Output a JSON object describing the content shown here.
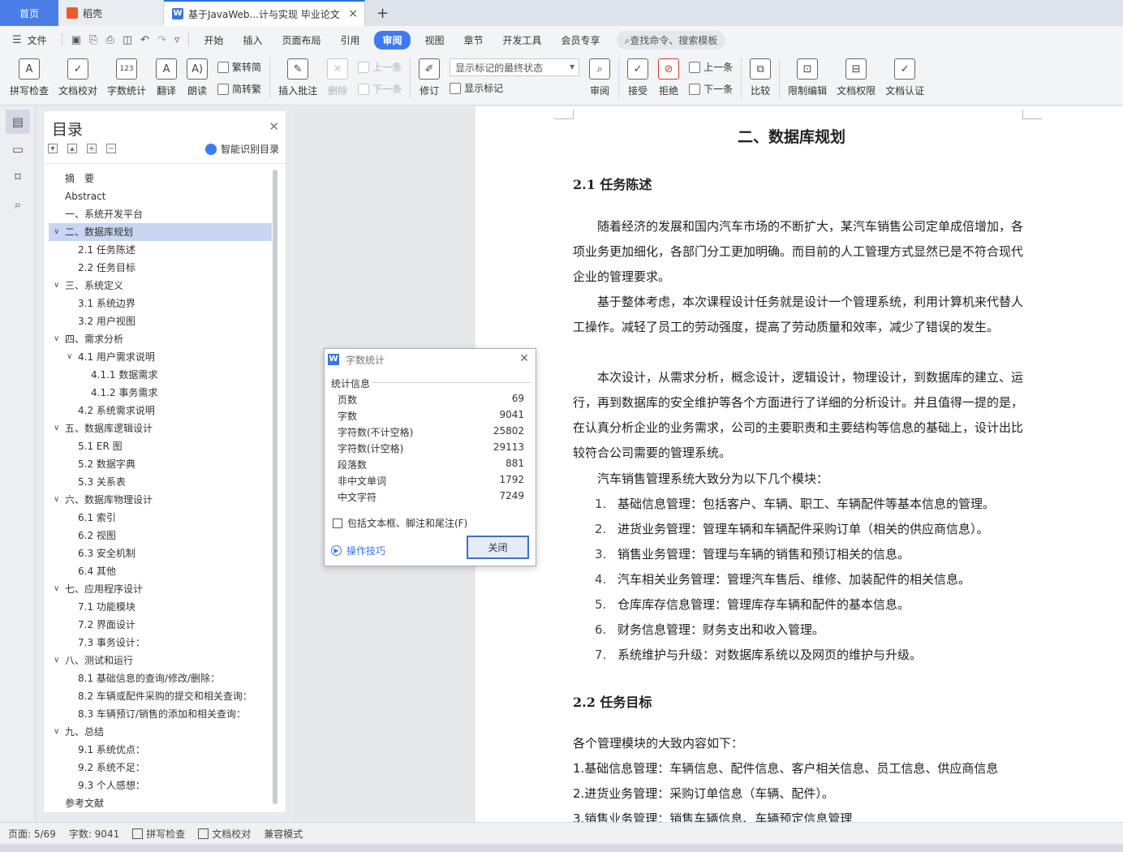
{
  "tabs": {
    "home": "首页",
    "daoke": "稻壳",
    "doc": "基于JavaWeb...计与实现 毕业论文",
    "add": "+"
  },
  "menu": {
    "file": "文件",
    "items": [
      "开始",
      "插入",
      "页面布局",
      "引用",
      "审阅",
      "视图",
      "章节",
      "开发工具",
      "会员专享"
    ],
    "active": "审阅",
    "search": "查找命令、搜索模板"
  },
  "ribbon": {
    "spell": "拼写检查",
    "proof": "文档校对",
    "wordcount": "字数统计",
    "translate": "翻译",
    "read": "朗读",
    "t2s": "繁转简",
    "s2t": "简转繁",
    "insert_comment": "插入批注",
    "delete": "删除",
    "prev_comment": "上一条",
    "next_comment": "下一条",
    "revise": "修订",
    "markup_select": "显示标记的最终状态",
    "show_markup": "显示标记",
    "review": "审阅",
    "accept": "接受",
    "reject": "拒绝",
    "prev_change": "上一条",
    "next_change": "下一条",
    "compare": "比较",
    "restrict": "限制编辑",
    "permission": "文档权限",
    "certify": "文档认证"
  },
  "toc": {
    "title": "目录",
    "smart": "智能识别目录",
    "items": [
      {
        "label": "摘　要",
        "level": 0,
        "arrow": ""
      },
      {
        "label": "Abstract",
        "level": 0,
        "arrow": ""
      },
      {
        "label": "一、系统开发平台",
        "level": 0,
        "arrow": ""
      },
      {
        "label": "二、数据库规划",
        "level": 0,
        "arrow": "v",
        "selected": true
      },
      {
        "label": "2.1  任务陈述",
        "level": 1,
        "arrow": ""
      },
      {
        "label": "2.2  任务目标",
        "level": 1,
        "arrow": ""
      },
      {
        "label": "三、系统定义",
        "level": 0,
        "arrow": "v"
      },
      {
        "label": "3.1  系统边界",
        "level": 1,
        "arrow": ""
      },
      {
        "label": "3.2  用户视图",
        "level": 1,
        "arrow": ""
      },
      {
        "label": "四、需求分析",
        "level": 0,
        "arrow": "v"
      },
      {
        "label": "4.1  用户需求说明",
        "level": 1,
        "arrow": "v"
      },
      {
        "label": "4.1.1  数据需求",
        "level": 2,
        "arrow": ""
      },
      {
        "label": "4.1.2  事务需求",
        "level": 2,
        "arrow": ""
      },
      {
        "label": "4.2  系统需求说明",
        "level": 1,
        "arrow": ""
      },
      {
        "label": "五、数据库逻辑设计",
        "level": 0,
        "arrow": "v"
      },
      {
        "label": "5.1 ER 图",
        "level": 1,
        "arrow": ""
      },
      {
        "label": "5.2  数据字典",
        "level": 1,
        "arrow": ""
      },
      {
        "label": "5.3  关系表",
        "level": 1,
        "arrow": ""
      },
      {
        "label": "六、数据库物理设计",
        "level": 0,
        "arrow": "v"
      },
      {
        "label": "6.1 索引",
        "level": 1,
        "arrow": ""
      },
      {
        "label": "6.2 视图",
        "level": 1,
        "arrow": ""
      },
      {
        "label": "6.3 安全机制",
        "level": 1,
        "arrow": ""
      },
      {
        "label": "6.4 其他",
        "level": 1,
        "arrow": ""
      },
      {
        "label": "七、应用程序设计",
        "level": 0,
        "arrow": "v"
      },
      {
        "label": "7.1 功能模块",
        "level": 1,
        "arrow": ""
      },
      {
        "label": "7.2 界面设计",
        "level": 1,
        "arrow": ""
      },
      {
        "label": "7.3 事务设计：",
        "level": 1,
        "arrow": ""
      },
      {
        "label": "八、测试和运行",
        "level": 0,
        "arrow": "v"
      },
      {
        "label": "8.1 基础信息的查询/修改/删除：",
        "level": 1,
        "arrow": ""
      },
      {
        "label": "8.2 车辆或配件采购的提交和相关查询：",
        "level": 1,
        "arrow": ""
      },
      {
        "label": "8.3 车辆预订/销售的添加和相关查询：",
        "level": 1,
        "arrow": ""
      },
      {
        "label": "九、总结",
        "level": 0,
        "arrow": "v"
      },
      {
        "label": "9.1 系统优点：",
        "level": 1,
        "arrow": ""
      },
      {
        "label": "9.2 系统不足：",
        "level": 1,
        "arrow": ""
      },
      {
        "label": "9.3 个人感想：",
        "level": 1,
        "arrow": ""
      },
      {
        "label": "参考文献",
        "level": 0,
        "arrow": ""
      }
    ]
  },
  "doc": {
    "h1": "二、数据库规划",
    "h2_1": "2.1  任务陈述",
    "p1": "随着经济的发展和国内汽车市场的不断扩大，某汽车销售公司定单成倍增加，各项业务更加细化，各部门分工更加明确。而目前的人工管理方式显然已是不符合现代企业的管理要求。",
    "p2": "基于整体考虑，本次课程设计任务就是设计一个管理系统，利用计算机来代替人工操作。减轻了员工的劳动强度，提高了劳动质量和效率，减少了错误的发生。",
    "p3": "本次设计，从需求分析，概念设计，逻辑设计，物理设计，到数据库的建立、运行，再到数据库的安全维护等各个方面进行了详细的分析设计。并且值得一提的是，在认真分析企业的业务需求，公司的主要职责和主要结构等信息的基础上，设计出比较符合公司需要的管理系统。",
    "p4": "汽车销售管理系统大致分为以下几个模块：",
    "list": [
      {
        "num": "1.",
        "text": "基础信息管理：包括客户、车辆、职工、车辆配件等基本信息的管理。"
      },
      {
        "num": "2.",
        "text": "进货业务管理：管理车辆和车辆配件采购订单（相关的供应商信息）。"
      },
      {
        "num": "3.",
        "text": "销售业务管理：管理与车辆的销售和预订相关的信息。"
      },
      {
        "num": "4.",
        "text": "汽车相关业务管理：管理汽车售后、维修、加装配件的相关信息。"
      },
      {
        "num": "5.",
        "text": "仓库库存信息管理：管理库存车辆和配件的基本信息。"
      },
      {
        "num": "6.",
        "text": "财务信息管理：财务支出和收入管理。"
      },
      {
        "num": "7.",
        "text": "系统维护与升级：对数据库系统以及网页的维护与升级。"
      }
    ],
    "h2_2": "2.2  任务目标",
    "p5": "各个管理模块的大致内容如下：",
    "p6": "1.基础信息管理：车辆信息、配件信息、客户相关信息、员工信息、供应商信息",
    "p7": "2.进货业务管理：采购订单信息（车辆、配件）。",
    "p8": "3.销售业务管理：销售车辆信息、车辆预定信息管理"
  },
  "dialog": {
    "title": "字数统计",
    "section": "统计信息",
    "rows": [
      {
        "label": "页数",
        "value": "69"
      },
      {
        "label": "字数",
        "value": "9041"
      },
      {
        "label": "字符数(不计空格)",
        "value": "25802"
      },
      {
        "label": "字符数(计空格)",
        "value": "29113"
      },
      {
        "label": "段落数",
        "value": "881"
      },
      {
        "label": "非中文单词",
        "value": "1792"
      },
      {
        "label": "中文字符",
        "value": "7249"
      }
    ],
    "checkbox": "包括文本框、脚注和尾注(F)",
    "tips": "操作技巧",
    "close_btn": "关闭"
  },
  "status": {
    "page": "页面: 5/69",
    "words": "字数: 9041",
    "spell": "拼写检查",
    "proof": "文档校对",
    "compat": "兼容模式"
  }
}
